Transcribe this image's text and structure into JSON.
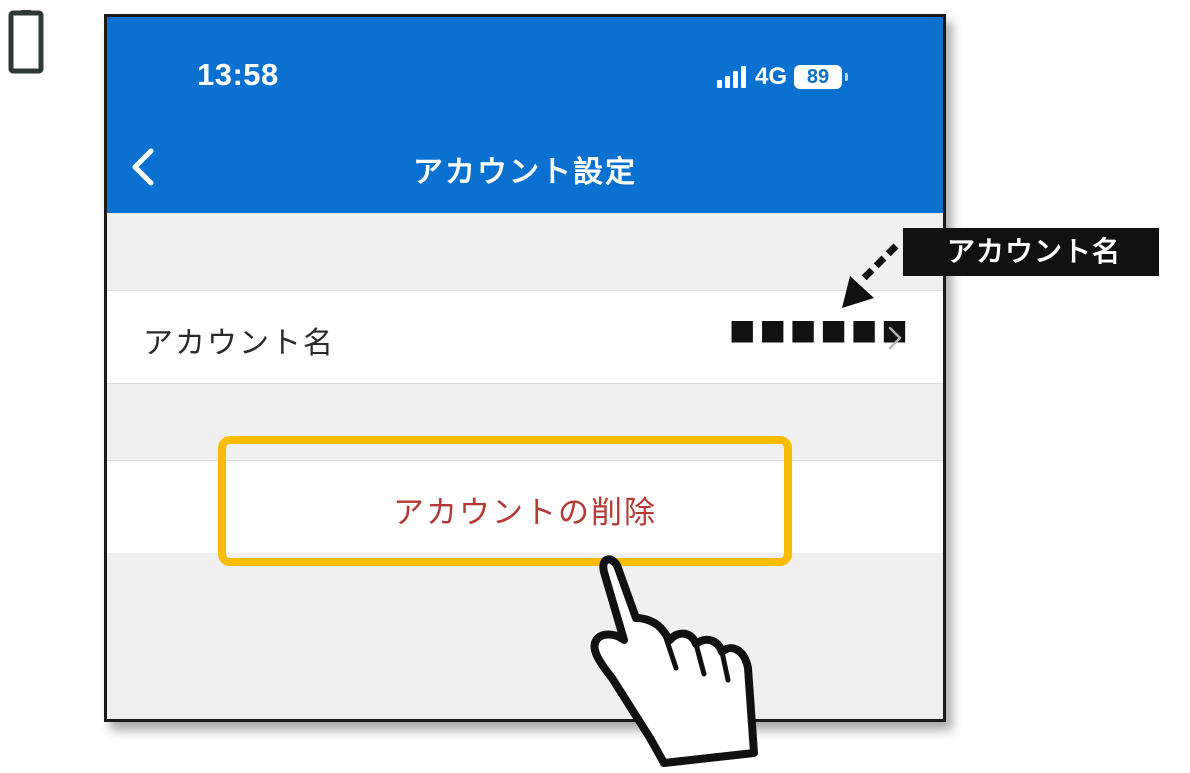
{
  "status_bar": {
    "time": "13:58",
    "network": "4G",
    "battery": "89"
  },
  "nav": {
    "title": "アカウント設定",
    "back_icon": "chevron-left-icon"
  },
  "account_row": {
    "label": "アカウント名",
    "value": "■■■■■■",
    "chevron_icon": "chevron-right-icon"
  },
  "delete_row": {
    "label": "アカウントの削除"
  },
  "annotation": {
    "callout_label": "アカウント名",
    "highlight_color": "#f9bc00"
  },
  "colors": {
    "header": "#0a71d1",
    "delete_text": "#b53a35",
    "background": "#f0f0f0"
  }
}
